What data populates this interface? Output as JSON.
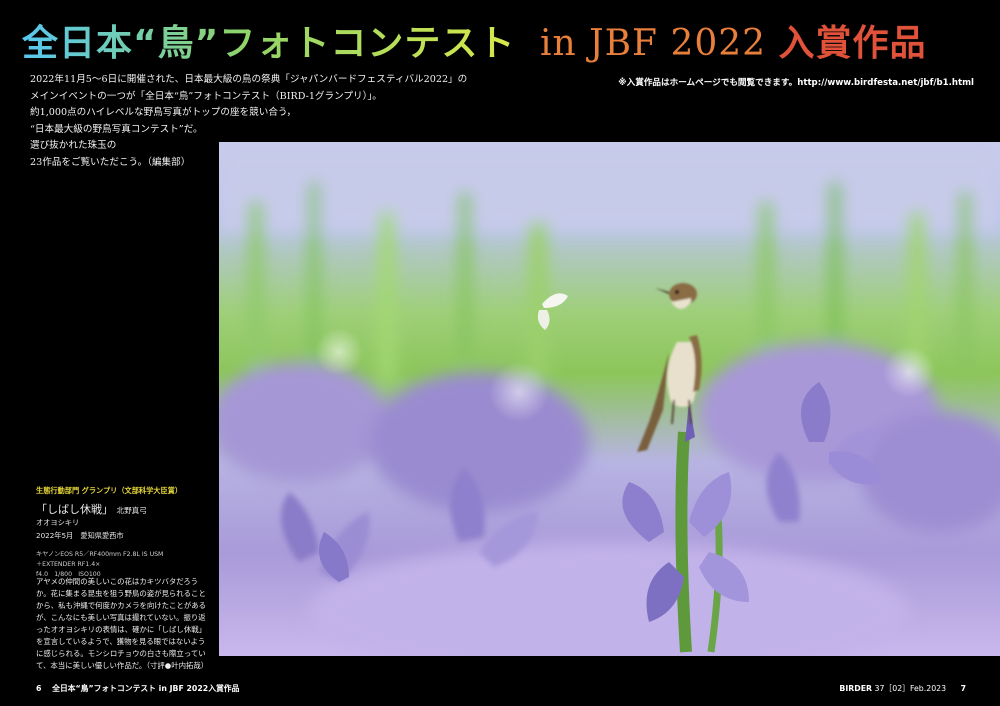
{
  "header": {
    "title_jp": "全日本“鳥”フォトコンテスト",
    "title_en": "in JBF 2022",
    "title_suffix": "入賞作品"
  },
  "intro": {
    "lines": [
      "2022年11月5～6日に開催された、日本最大級の鳥の祭典「ジャパンバードフェスティバル2022」の",
      "メインイベントの一つが「全日本“鳥”フォトコンテスト（BIRD-1グランプリ）」。",
      "約1,000点のハイレベルな野鳥写真がトップの座を競い合う，",
      "“日本最大級の野鳥写真コンテスト”だ。",
      "選び抜かれた珠玉の",
      "23作品をご覧いただこう。（編集部）"
    ]
  },
  "note": "※入賞作品はホームページでも閲覧できます。http://www.birdfesta.net/jbf/b1.html",
  "caption": {
    "award": "生態行動部門 グランプリ（文部科学大臣賞）",
    "work_title": "「しばし休戦」",
    "photographer": "北野真弓",
    "species": "オオヨシキリ",
    "date_place": "2022年5月　愛知県愛西市",
    "camera": "キヤノンEOS R5／RF400mm F2.8L IS USM",
    "extender": "＋EXTENDER RF1.4×",
    "settings": "f4.0　1/800　ISO100"
  },
  "comment": "アヤメの仲間の美しいこの花はカキツバタだろうか。花に集まる昆虫を狙う野鳥の姿が見られることから、私も沖縄で何度かカメラを向けたことがあるが、こんなにも美しい写真は撮れていない。振り返ったオオヨシキリの表情は、確かに「しばし休戦」を宣言しているようで、獲物を見る眼ではないように感じられる。モンシロチョウの白さも際立っていて、本当に美しい優しい作品だ。（寸評●叶内拓哉）",
  "footer": {
    "left_page": "6",
    "left_title": "全日本“鳥”フォトコンテスト in JBF 2022入賞作品",
    "brand": "BIRDER",
    "issue": "37［02］Feb.2023",
    "right_page": "7"
  }
}
